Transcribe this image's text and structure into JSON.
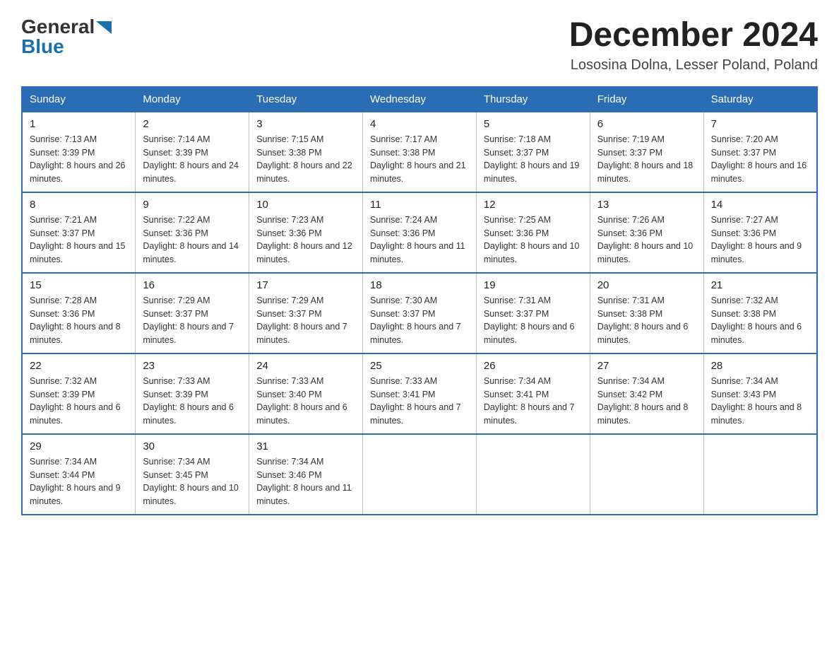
{
  "logo": {
    "general": "General",
    "blue": "Blue",
    "arrow": "▶"
  },
  "header": {
    "month_title": "December 2024",
    "subtitle": "Lososina Dolna, Lesser Poland, Poland"
  },
  "days_of_week": [
    "Sunday",
    "Monday",
    "Tuesday",
    "Wednesday",
    "Thursday",
    "Friday",
    "Saturday"
  ],
  "weeks": [
    [
      {
        "day": "1",
        "sunrise": "7:13 AM",
        "sunset": "3:39 PM",
        "daylight": "8 hours and 26 minutes."
      },
      {
        "day": "2",
        "sunrise": "7:14 AM",
        "sunset": "3:39 PM",
        "daylight": "8 hours and 24 minutes."
      },
      {
        "day": "3",
        "sunrise": "7:15 AM",
        "sunset": "3:38 PM",
        "daylight": "8 hours and 22 minutes."
      },
      {
        "day": "4",
        "sunrise": "7:17 AM",
        "sunset": "3:38 PM",
        "daylight": "8 hours and 21 minutes."
      },
      {
        "day": "5",
        "sunrise": "7:18 AM",
        "sunset": "3:37 PM",
        "daylight": "8 hours and 19 minutes."
      },
      {
        "day": "6",
        "sunrise": "7:19 AM",
        "sunset": "3:37 PM",
        "daylight": "8 hours and 18 minutes."
      },
      {
        "day": "7",
        "sunrise": "7:20 AM",
        "sunset": "3:37 PM",
        "daylight": "8 hours and 16 minutes."
      }
    ],
    [
      {
        "day": "8",
        "sunrise": "7:21 AM",
        "sunset": "3:37 PM",
        "daylight": "8 hours and 15 minutes."
      },
      {
        "day": "9",
        "sunrise": "7:22 AM",
        "sunset": "3:36 PM",
        "daylight": "8 hours and 14 minutes."
      },
      {
        "day": "10",
        "sunrise": "7:23 AM",
        "sunset": "3:36 PM",
        "daylight": "8 hours and 12 minutes."
      },
      {
        "day": "11",
        "sunrise": "7:24 AM",
        "sunset": "3:36 PM",
        "daylight": "8 hours and 11 minutes."
      },
      {
        "day": "12",
        "sunrise": "7:25 AM",
        "sunset": "3:36 PM",
        "daylight": "8 hours and 10 minutes."
      },
      {
        "day": "13",
        "sunrise": "7:26 AM",
        "sunset": "3:36 PM",
        "daylight": "8 hours and 10 minutes."
      },
      {
        "day": "14",
        "sunrise": "7:27 AM",
        "sunset": "3:36 PM",
        "daylight": "8 hours and 9 minutes."
      }
    ],
    [
      {
        "day": "15",
        "sunrise": "7:28 AM",
        "sunset": "3:36 PM",
        "daylight": "8 hours and 8 minutes."
      },
      {
        "day": "16",
        "sunrise": "7:29 AM",
        "sunset": "3:37 PM",
        "daylight": "8 hours and 7 minutes."
      },
      {
        "day": "17",
        "sunrise": "7:29 AM",
        "sunset": "3:37 PM",
        "daylight": "8 hours and 7 minutes."
      },
      {
        "day": "18",
        "sunrise": "7:30 AM",
        "sunset": "3:37 PM",
        "daylight": "8 hours and 7 minutes."
      },
      {
        "day": "19",
        "sunrise": "7:31 AM",
        "sunset": "3:37 PM",
        "daylight": "8 hours and 6 minutes."
      },
      {
        "day": "20",
        "sunrise": "7:31 AM",
        "sunset": "3:38 PM",
        "daylight": "8 hours and 6 minutes."
      },
      {
        "day": "21",
        "sunrise": "7:32 AM",
        "sunset": "3:38 PM",
        "daylight": "8 hours and 6 minutes."
      }
    ],
    [
      {
        "day": "22",
        "sunrise": "7:32 AM",
        "sunset": "3:39 PM",
        "daylight": "8 hours and 6 minutes."
      },
      {
        "day": "23",
        "sunrise": "7:33 AM",
        "sunset": "3:39 PM",
        "daylight": "8 hours and 6 minutes."
      },
      {
        "day": "24",
        "sunrise": "7:33 AM",
        "sunset": "3:40 PM",
        "daylight": "8 hours and 6 minutes."
      },
      {
        "day": "25",
        "sunrise": "7:33 AM",
        "sunset": "3:41 PM",
        "daylight": "8 hours and 7 minutes."
      },
      {
        "day": "26",
        "sunrise": "7:34 AM",
        "sunset": "3:41 PM",
        "daylight": "8 hours and 7 minutes."
      },
      {
        "day": "27",
        "sunrise": "7:34 AM",
        "sunset": "3:42 PM",
        "daylight": "8 hours and 8 minutes."
      },
      {
        "day": "28",
        "sunrise": "7:34 AM",
        "sunset": "3:43 PM",
        "daylight": "8 hours and 8 minutes."
      }
    ],
    [
      {
        "day": "29",
        "sunrise": "7:34 AM",
        "sunset": "3:44 PM",
        "daylight": "8 hours and 9 minutes."
      },
      {
        "day": "30",
        "sunrise": "7:34 AM",
        "sunset": "3:45 PM",
        "daylight": "8 hours and 10 minutes."
      },
      {
        "day": "31",
        "sunrise": "7:34 AM",
        "sunset": "3:46 PM",
        "daylight": "8 hours and 11 minutes."
      },
      null,
      null,
      null,
      null
    ]
  ],
  "labels": {
    "sunrise": "Sunrise:",
    "sunset": "Sunset:",
    "daylight": "Daylight:"
  }
}
